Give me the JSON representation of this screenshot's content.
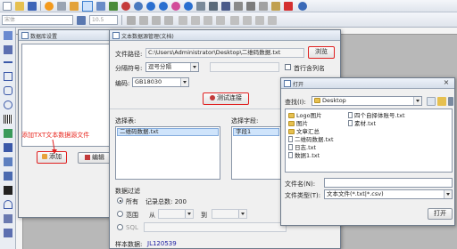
{
  "colors": {
    "accent": "#e02020",
    "selection": "#cfe4fb",
    "link": "#1a1aa0"
  },
  "toolbar": {
    "font_placeholder": "宋体",
    "font_size": "10.5",
    "icons": [
      "new-icon",
      "open-icon",
      "save-icon",
      "print-icon",
      "database-icon",
      "undo-icon",
      "redo-icon",
      "zoom-in-icon",
      "zoom-out-icon",
      "grid-icon",
      "pdf-icon",
      "user-icon"
    ]
  },
  "annotation": {
    "text": "添加TXT文本数据源文件"
  },
  "db_window": {
    "title": "数据库设置",
    "add_label": "添加",
    "edit_label": "编辑"
  },
  "txt_window": {
    "title": "文本数据源管理(文档)",
    "file_path_label": "文件路径:",
    "file_path_value": "C:\\Users\\Administrator\\Desktop\\二维码数据.txt",
    "browse_label": "浏览",
    "separator_label": "分隔符号:",
    "separator_value": "逗号分隔",
    "first_row_label": "首行含列名",
    "encoding_label": "编码:",
    "encoding_value": "GB18030",
    "test_connect_label": "测试连接",
    "table_label": "选择表:",
    "field_label": "选择字段:",
    "table_item": "二维码数据.txt",
    "field_item": "字段1",
    "filter_label": "数据过滤",
    "all_label": "所有",
    "record_count": "记录总数: 200",
    "range_label": "范围",
    "from_label": "从",
    "to_label": "到",
    "sql_label": "SQL",
    "sample_label": "样本数据:",
    "sample_value": "JL120539"
  },
  "open_dialog": {
    "title": "打开",
    "lookin_label": "查找(I):",
    "lookin_value": "Desktop",
    "items": [
      {
        "name": "Logo图片",
        "type": "folder"
      },
      {
        "name": "图片",
        "type": "folder"
      },
      {
        "name": "文章汇总",
        "type": "folder"
      },
      {
        "name": "二维码数据.txt",
        "type": "doc"
      },
      {
        "name": "日志.txt",
        "type": "doc"
      },
      {
        "name": "数据1.txt",
        "type": "doc"
      }
    ],
    "items2": [
      {
        "name": "四个自择体账号.txt",
        "type": "doc"
      },
      {
        "name": "素材.txt",
        "type": "doc"
      }
    ],
    "filename_label": "文件名(N):",
    "filetype_label": "文件类型(T):",
    "filetype_value": "文本文件(*.txt|*.csv)",
    "open_label": "打开"
  }
}
